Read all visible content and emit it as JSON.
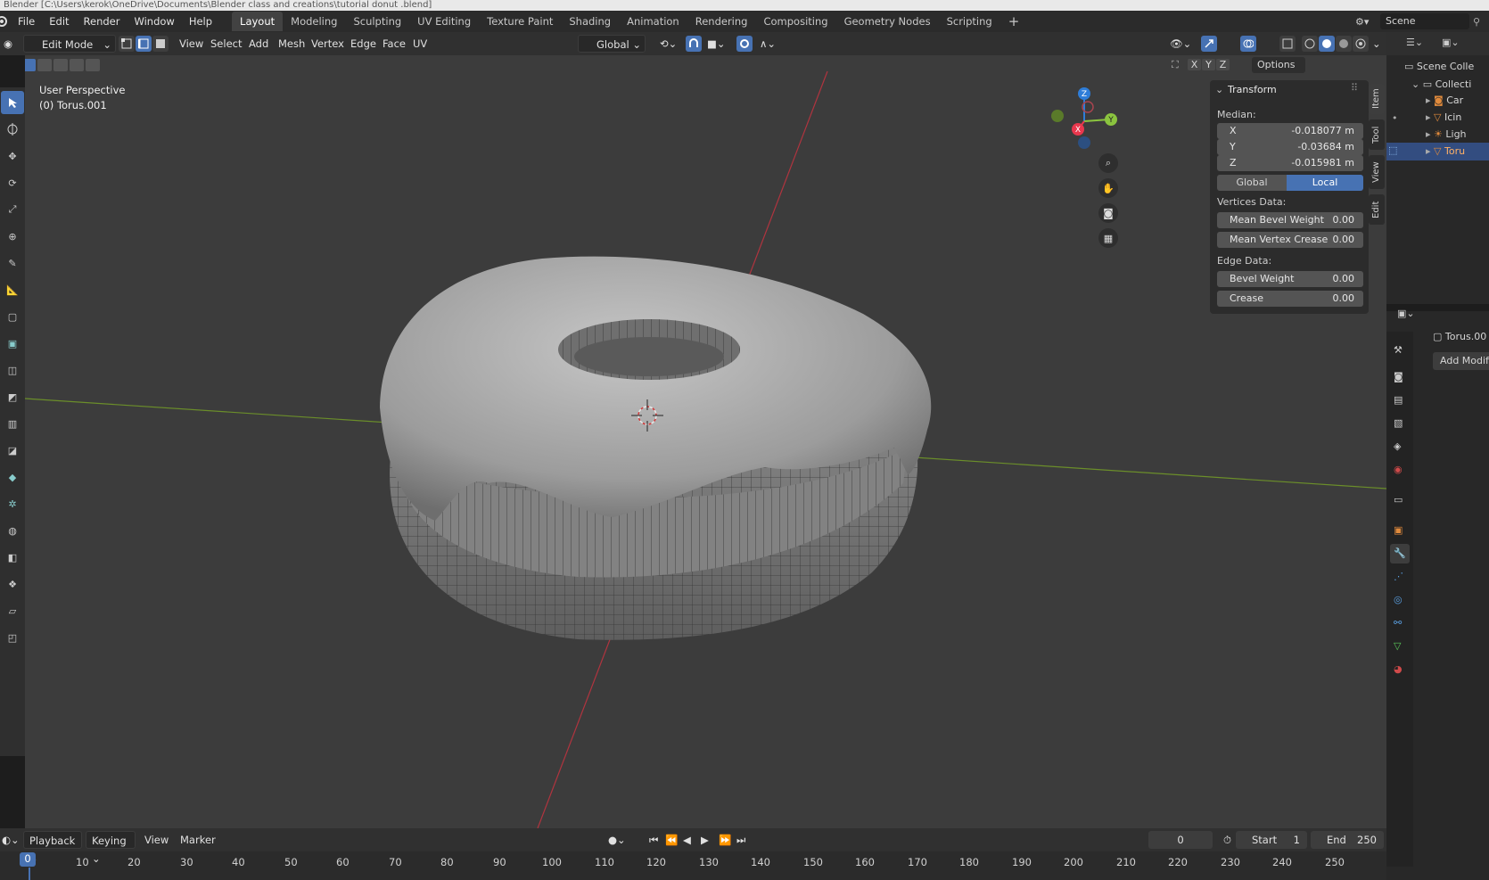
{
  "window": {
    "title": "Blender  [C:\\Users\\kerok\\OneDrive\\Documents\\Blender class and creations\\tutorial donut .blend]"
  },
  "menu": [
    "File",
    "Edit",
    "Render",
    "Window",
    "Help"
  ],
  "workspaces": [
    "Layout",
    "Modeling",
    "Sculpting",
    "UV Editing",
    "Texture Paint",
    "Shading",
    "Animation",
    "Rendering",
    "Compositing",
    "Geometry Nodes",
    "Scripting"
  ],
  "active_workspace": "Layout",
  "scene": {
    "label": "Scene"
  },
  "header": {
    "mode": "Edit Mode",
    "menus": [
      "View",
      "Select",
      "Add",
      "Mesh",
      "Vertex",
      "Edge",
      "Face",
      "UV"
    ],
    "orientation": "Global",
    "axes": [
      "X",
      "Y",
      "Z"
    ],
    "options": "Options"
  },
  "viewport": {
    "perspective": "User Perspective",
    "object": "(0) Torus.001"
  },
  "gizmo": {
    "z": "Z",
    "y": "Y",
    "x": "X"
  },
  "npanel": {
    "title": "Transform",
    "median_label": "Median:",
    "x_key": "X",
    "x": "-0.018077 m",
    "y_key": "Y",
    "y": "-0.03684 m",
    "z_key": "Z",
    "z": "-0.015981 m",
    "global": "Global",
    "local": "Local",
    "vertices_label": "Vertices Data:",
    "mean_bevel": "Mean Bevel Weight",
    "mean_bevel_val": "0.00",
    "mean_crease": "Mean Vertex Crease",
    "mean_crease_val": "0.00",
    "edge_label": "Edge Data:",
    "bevel": "Bevel Weight",
    "bevel_val": "0.00",
    "crease": "Crease",
    "crease_val": "0.00",
    "tabs": [
      "Item",
      "Tool",
      "View",
      "Edit"
    ]
  },
  "outliner": {
    "root": "Scene Colle",
    "collection": "Collecti",
    "items": [
      "Car",
      "Icin",
      "Ligh",
      "Toru"
    ]
  },
  "properties": {
    "object": "Torus.00",
    "add_modifier": "Add Modifie"
  },
  "timeline": {
    "playback": "Playback",
    "keying": "Keying",
    "view": "View",
    "marker": "Marker",
    "current": "0",
    "start_label": "Start",
    "start": "1",
    "end_label": "End",
    "end": "250",
    "ticks": [
      "0",
      "10",
      "20",
      "30",
      "40",
      "50",
      "60",
      "70",
      "80",
      "90",
      "100",
      "110",
      "120",
      "130",
      "140",
      "150",
      "160",
      "170",
      "180",
      "190",
      "200",
      "210",
      "220",
      "230",
      "240",
      "250"
    ]
  },
  "colors": {
    "accent": "#4772b3",
    "x_axis": "#e8374d",
    "y_axis": "#8bc43f",
    "z_axis": "#2e7dd8"
  }
}
